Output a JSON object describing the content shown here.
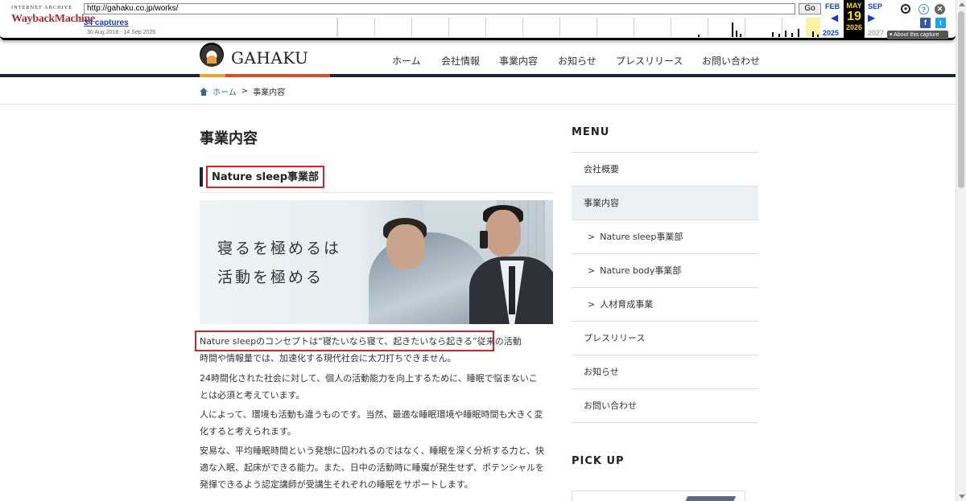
{
  "wayback": {
    "logo_top": "INTERNET ARCHIVE",
    "logo_main": "WaybackMachine",
    "url": "http://gahaku.co.jp/works/",
    "go_label": "Go",
    "captures": "34 captures",
    "range": "30 Aug 2018 - 14 Sep 2026",
    "prev_month": "FEB",
    "cur_month": "MAY",
    "cur_day": "19",
    "next_month": "SEP",
    "prev_year": "2025",
    "cur_year": "2026",
    "next_year": "2027",
    "about": "About this capture",
    "icons": {
      "user": "user-icon",
      "help": "help-icon",
      "close": "close-icon",
      "facebook": "facebook-icon",
      "twitter": "twitter-icon"
    }
  },
  "site": {
    "logo": "GAHAKU",
    "nav": [
      "ホーム",
      "会社情報",
      "事業内容",
      "お知らせ",
      "プレスリリース",
      "お問い合わせ"
    ]
  },
  "breadcrumb": {
    "home": "ホーム",
    "separator": ">",
    "current": "事業内容"
  },
  "main": {
    "title": "事業内容",
    "section": "Nature sleep事業部",
    "hero_line1": "寝るを極めるは",
    "hero_line2": "活動を極める",
    "p1a": "Nature sleepのコンセプトは“寝たいなら寝て、起きたいなら起きる”従来の活動",
    "p1b": "時間や情報量では、加速化する現代社会に太刀打ちできません。",
    "p2": "24時間化された社会に対して、個人の活動能力を向上するために、睡眠で悩まないことは必須と考えています。",
    "p3": "人によって、環境も活動も違うものです。当然、最適な睡眠環境や睡眠時間も大きく変化すると考えられます。",
    "p4": "安易な、平均睡眠時間という発想に囚われるのではなく、睡眠を深く分析する力と、快適な入眠、起床ができる能力。また、日中の活動時に睡魔が発生せず、ポテンシャルを発揮できるよう認定講師が受講生それぞれの睡眠をサポートします。"
  },
  "sidebar": {
    "title": "MENU",
    "items": [
      "会社概要",
      "事業内容",
      "Nature sleep事業部",
      "Nature body事業部",
      "人材育成事業",
      "プレスリリース",
      "お知らせ",
      "お問い合わせ"
    ],
    "pickup": "PICK UP"
  }
}
